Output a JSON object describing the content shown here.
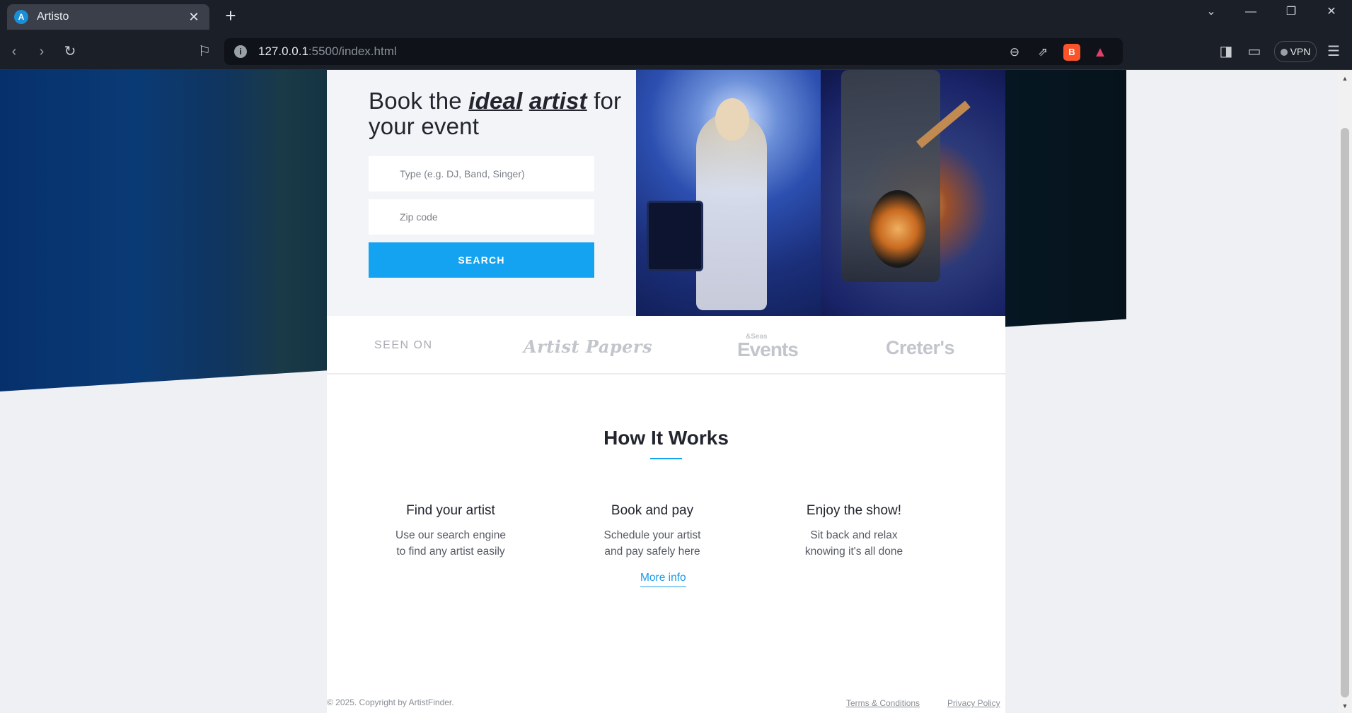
{
  "browser": {
    "tab_title": "Artisto",
    "tab_favicon_letter": "A",
    "url_host": "127.0.0.1",
    "url_port_path": ":5500/index.html",
    "vpn_label": "VPN"
  },
  "hero": {
    "title_before": "Book the ",
    "title_em1": "ideal",
    "title_space": " ",
    "title_em2": "artist",
    "title_after": " for your event",
    "type_placeholder": "Type (e.g. DJ, Band, Singer)",
    "zip_placeholder": "Zip code",
    "search_label": "SEARCH"
  },
  "seen_on": {
    "label": "SEEN ON",
    "logos": [
      "Artist Papers",
      "Events",
      "Creter's"
    ],
    "events_small": "&Seas"
  },
  "how_it_works": {
    "title": "How It Works",
    "steps": [
      {
        "title": "Find your artist",
        "line1": "Use our search engine",
        "line2": "to find any artist easily"
      },
      {
        "title": "Book and pay",
        "line1": "Schedule your artist",
        "line2": "and pay safely here"
      },
      {
        "title": "Enjoy the show!",
        "line1": "Sit back and relax",
        "line2": "knowing it's all done"
      }
    ],
    "more_info": "More info"
  },
  "footer": {
    "copyright": "© 2025. Copyright by ArtistFinder.",
    "terms": "Terms & Conditions",
    "privacy": "Privacy Policy"
  },
  "colors": {
    "accent": "#14a3f0",
    "chrome": "#1b1f27"
  }
}
